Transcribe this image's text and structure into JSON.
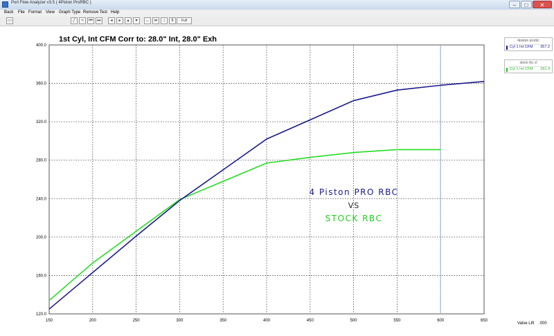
{
  "window": {
    "title": "Port Flow Analyzer v3.5  ( 4Piston ProRBC )",
    "controls": {
      "minimize": "–",
      "maximize": "□",
      "close": "✕"
    }
  },
  "menu": [
    "Back",
    "File",
    "Format",
    "View",
    "Graph Type",
    "Remove Test",
    "Help"
  ],
  "toolbar": {
    "print_icon": "printer-icon",
    "full_view_label": "Full View"
  },
  "graph": {
    "header": "1st Cyl, Int CFM    Corr to: 28.0\" Int, 28.0\" Exh",
    "x_axis_label": "Valve Lift",
    "x_axis_unit": ".000",
    "annotation": {
      "line1": "4 Piston PRO RBC",
      "vs": "VS",
      "line2": "STOCK RBC"
    }
  },
  "legend": [
    {
      "title": "4piston prorbc",
      "name": "Cyl 1 Int CFM",
      "value": "357.2",
      "color": "#1a1a8c"
    },
    {
      "title": "stock rbc cl",
      "name": "Cyl 1 Int CFM",
      "value": "291.4",
      "color": "#22cc22"
    }
  ],
  "colors": {
    "series1": "#1a1a8c",
    "series2": "#22dd22",
    "grid": "#555555"
  },
  "chart_data": {
    "type": "line",
    "title": "1st Cyl, Int CFM    Corr to: 28.0\" Int, 28.0\" Exh",
    "xlabel": "Valve Lift .000",
    "ylabel": "",
    "xlim": [
      150,
      650
    ],
    "ylim": [
      120,
      400
    ],
    "x_ticks": [
      "150",
      "200",
      "250",
      "300",
      "350",
      "400",
      "450",
      "500",
      "550",
      "600",
      "650"
    ],
    "y_ticks": [
      "400.0",
      "360.0",
      "320.0",
      "280.0",
      "240.0",
      "200.0",
      "160.0",
      "120.0"
    ],
    "grid": true,
    "series": [
      {
        "name": "4piston prorbc",
        "x": [
          150,
          200,
          250,
          300,
          350,
          400,
          450,
          500,
          550,
          600,
          650
        ],
        "y": [
          125,
          163,
          201,
          238,
          270,
          302,
          322,
          342,
          353,
          358,
          362
        ]
      },
      {
        "name": "stock rbc cl",
        "x": [
          150,
          200,
          250,
          300,
          350,
          400,
          450,
          500,
          550,
          600
        ],
        "y": [
          134,
          173,
          206,
          239,
          258,
          277,
          283,
          288,
          291,
          291
        ]
      }
    ]
  }
}
